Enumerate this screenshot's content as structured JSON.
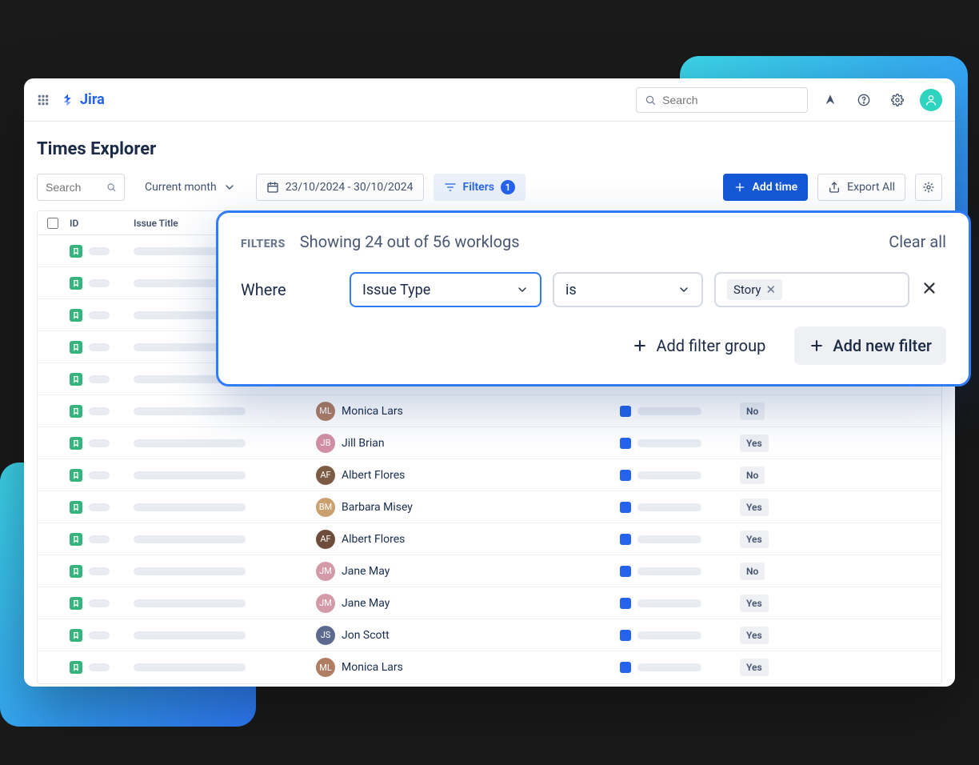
{
  "app": {
    "name": "Jira"
  },
  "topbar": {
    "search_placeholder": "Search"
  },
  "page": {
    "title": "Times Explorer"
  },
  "toolbar": {
    "search_placeholder": "Search",
    "period_label": "Current month",
    "date_range": "23/10/2024 - 30/10/2024",
    "filters_label": "Filters",
    "filters_count": "1",
    "add_time": "Add time",
    "export_all": "Export All"
  },
  "table": {
    "columns": {
      "id": "ID",
      "title": "Issue Title"
    },
    "rows": [
      {
        "user": "",
        "billable": "",
        "status": ""
      },
      {
        "user": "",
        "billable": "",
        "status": ""
      },
      {
        "user": "",
        "billable": "",
        "status": ""
      },
      {
        "user": "",
        "billable": "",
        "status": ""
      },
      {
        "user": "",
        "billable": "",
        "status": ""
      },
      {
        "user": "Monica Lars",
        "billable": "No",
        "status": "red"
      },
      {
        "user": "Jill Brian",
        "billable": "Yes",
        "status": "gray"
      },
      {
        "user": "Albert Flores",
        "billable": "No",
        "status": "green"
      },
      {
        "user": "Barbara Misey",
        "billable": "Yes",
        "status": "yellow"
      },
      {
        "user": "Albert Flores",
        "billable": "Yes",
        "status": "green"
      },
      {
        "user": "Jane May",
        "billable": "No",
        "status": "red"
      },
      {
        "user": "Jane May",
        "billable": "Yes",
        "status": "green"
      },
      {
        "user": "Jon Scott",
        "billable": "Yes",
        "status": "yellow"
      },
      {
        "user": "Monica Lars",
        "billable": "Yes",
        "status": "green"
      }
    ]
  },
  "popover": {
    "label": "FILTERS",
    "summary": "Showing 24 out of 56 worklogs",
    "clear": "Clear all",
    "where": "Where",
    "field": "Issue Type",
    "operator": "is",
    "value_token": "Story",
    "add_group": "Add filter group",
    "add_filter": "Add new filter"
  },
  "avatar_colors": [
    "#b07d62",
    "#d38fa4",
    "#7d5a44",
    "#caa06f",
    "#6f4c3a",
    "#d49aa8",
    "#d49aa8",
    "#5d6a8f",
    "#b07d62"
  ],
  "status_color_map": {
    "green": "status-green",
    "red": "status-red",
    "yellow": "status-yellow",
    "gray": "status-gray"
  }
}
